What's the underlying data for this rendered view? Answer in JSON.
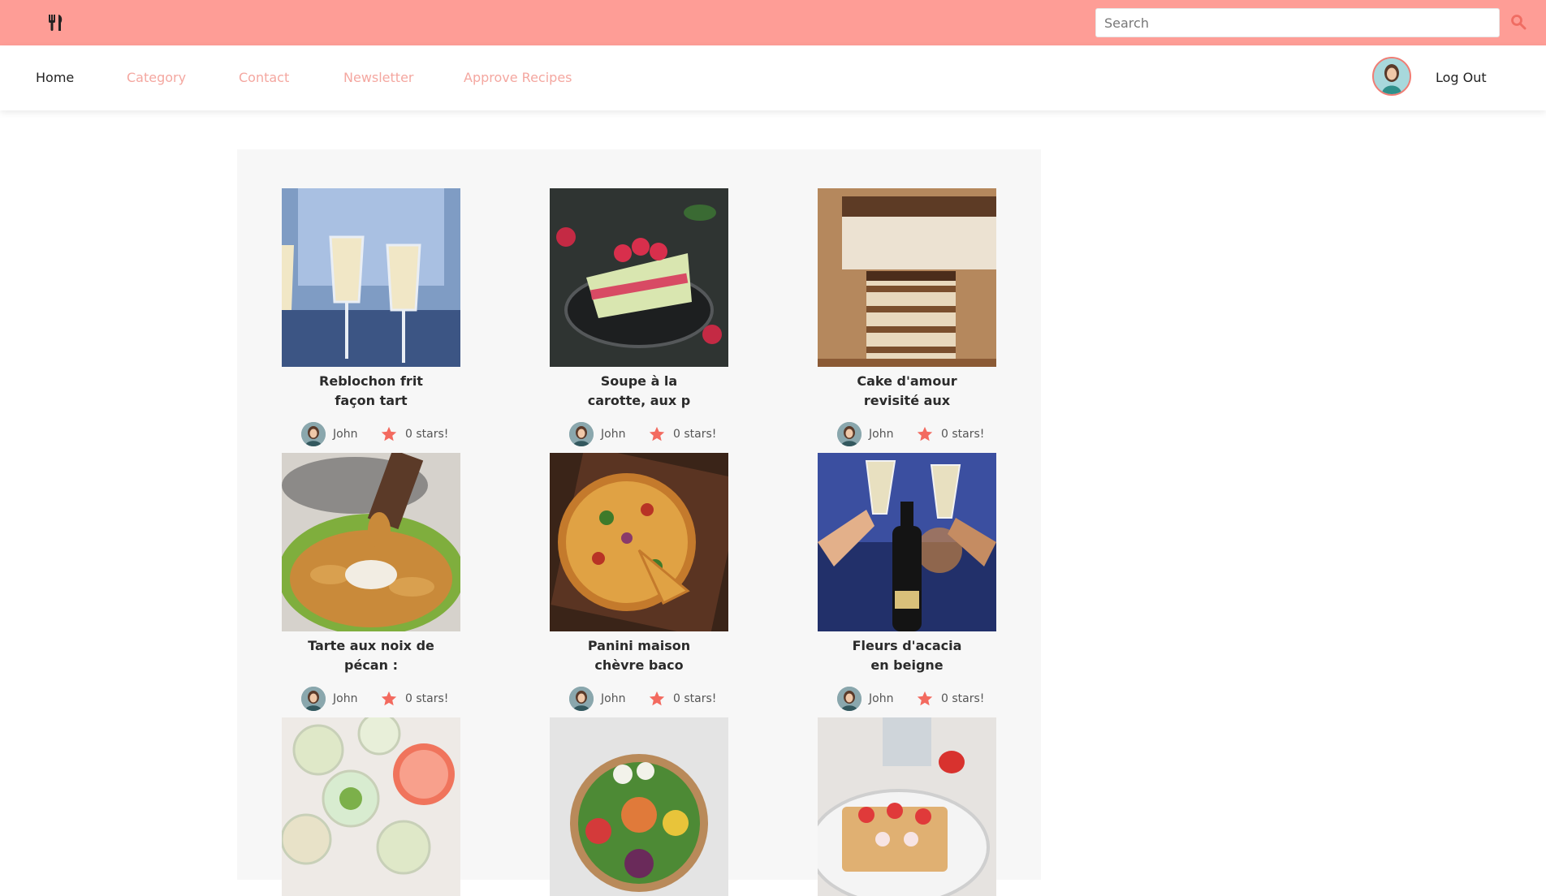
{
  "topbar": {
    "logo_icon": "utensils-icon",
    "search": {
      "placeholder": "Search",
      "value": "",
      "icon": "search-icon"
    },
    "color": "#fe9d96"
  },
  "nav": {
    "items": [
      {
        "label": "Home",
        "active": true
      },
      {
        "label": "Category",
        "active": false
      },
      {
        "label": "Contact",
        "active": false
      },
      {
        "label": "Newsletter",
        "active": false
      },
      {
        "label": "Approve Recipes",
        "active": false
      }
    ],
    "logout_label": "Log Out",
    "accent_color": "#f4a7a0"
  },
  "recipes": [
    {
      "title_line1": "Reblochon frit",
      "title_line2": "façon tart",
      "author": "John",
      "rating": "0 stars!",
      "image": "champagne-glasses"
    },
    {
      "title_line1": "Soupe à la",
      "title_line2": "carotte, aux p",
      "author": "John",
      "rating": "0 stars!",
      "image": "raspberry-cake"
    },
    {
      "title_line1": "Cake d'amour",
      "title_line2": "revisité aux",
      "author": "John",
      "rating": "0 stars!",
      "image": "tiramisu"
    },
    {
      "title_line1": "Tarte aux noix de",
      "title_line2": "pécan :",
      "author": "John",
      "rating": "0 stars!",
      "image": "fried-chicken"
    },
    {
      "title_line1": "Panini maison",
      "title_line2": "chèvre baco",
      "author": "John",
      "rating": "0 stars!",
      "image": "pizza"
    },
    {
      "title_line1": "Fleurs d'acacia",
      "title_line2": "en beigne",
      "author": "John",
      "rating": "0 stars!",
      "image": "champagne-toast"
    },
    {
      "title_line1": "",
      "title_line2": "",
      "author": "",
      "rating": "",
      "image": "citrus-drinks"
    },
    {
      "title_line1": "",
      "title_line2": "",
      "author": "",
      "rating": "",
      "image": "salad-bowl"
    },
    {
      "title_line1": "",
      "title_line2": "",
      "author": "",
      "rating": "",
      "image": "strawberry-pastry"
    }
  ]
}
